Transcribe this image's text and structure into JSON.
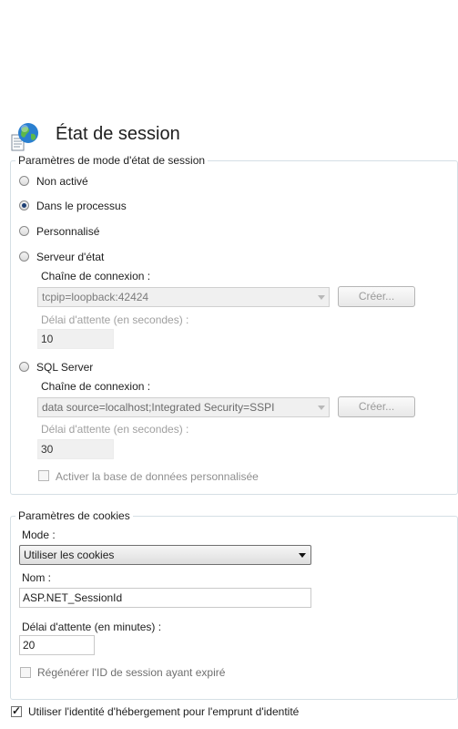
{
  "header": {
    "title": "État de session",
    "icon": "globe-document-icon"
  },
  "session_state": {
    "legend": "Paramètres de mode d'état de session",
    "modes": [
      {
        "label": "Non activé",
        "selected": false
      },
      {
        "label": "Dans le processus",
        "selected": true
      },
      {
        "label": "Personnalisé",
        "selected": false
      },
      {
        "label": "Serveur d'état",
        "selected": false
      },
      {
        "label": "SQL Server",
        "selected": false
      }
    ],
    "state_server": {
      "conn_label": "Chaîne de connexion :",
      "conn_value": "tcpip=loopback:42424",
      "create_button": "Créer...",
      "timeout_label": "Délai d'attente (en secondes) :",
      "timeout_value": "10"
    },
    "sql_server": {
      "conn_label": "Chaîne de connexion :",
      "conn_value": "data source=localhost;Integrated Security=SSPI",
      "create_button": "Créer...",
      "timeout_label": "Délai d'attente (en secondes) :",
      "timeout_value": "30",
      "custom_db_label": "Activer la base de données personnalisée",
      "custom_db_checked": false
    }
  },
  "cookies": {
    "legend": "Paramètres de cookies",
    "mode_label": "Mode :",
    "mode_value": "Utiliser les cookies",
    "name_label": "Nom :",
    "name_value": "ASP.NET_SessionId",
    "timeout_label": "Délai d'attente (en minutes) :",
    "timeout_value": "20",
    "regenerate_label": "Régénérer l'ID de session ayant expiré",
    "regenerate_checked": false
  },
  "impersonation": {
    "label": "Utiliser l'identité d'hébergement pour l'emprunt d'identité",
    "checked": true
  },
  "colors": {
    "radio_dot": "#1d3f74",
    "border": "#d5dfe5",
    "disabled_text": "#a0a0a0"
  }
}
